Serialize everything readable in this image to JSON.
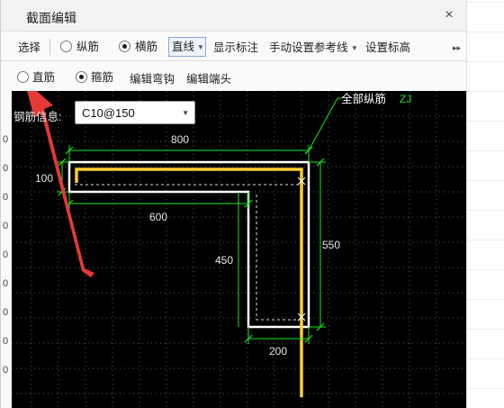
{
  "window": {
    "title": "截面编辑",
    "close_symbol": "×"
  },
  "toolbar1": {
    "select_label": "选择",
    "longitudinal_label": "纵筋",
    "transverse_label": "横筋",
    "line_label": "直线",
    "show_dimensions_label": "显示标注",
    "manual_guides_label": "手动设置参考线",
    "set_elevation_label": "设置标高",
    "overflow_symbol": "▸▸"
  },
  "toolbar2": {
    "straight_label": "直筋",
    "stirrup_label": "箍筋",
    "edit_hook_label": "编辑弯钩",
    "edit_end_label": "编辑端头"
  },
  "rebar_info": {
    "label": "钢筋信息:",
    "value": "C10@150"
  },
  "canvas": {
    "all_longitudinal_label": "全部纵筋",
    "zj_label": "ZJ",
    "dims": {
      "top": "800",
      "left": "100",
      "inner_horizontal": "600",
      "inner_vertical": "450",
      "right": "550",
      "bottom": "200"
    },
    "left_edge_marks": [
      "0",
      "0",
      "0",
      "0",
      "0",
      "0",
      "0",
      "0",
      "0"
    ]
  },
  "state": {
    "transverse_selected": true,
    "longitudinal_selected": false,
    "straight_selected": false,
    "stirrup_selected": true
  },
  "colors": {
    "dimension_green": "#19e619",
    "rebar_yellow": "#ffcc33",
    "annotation_red": "#e53935",
    "canvas_bg": "#000000"
  }
}
